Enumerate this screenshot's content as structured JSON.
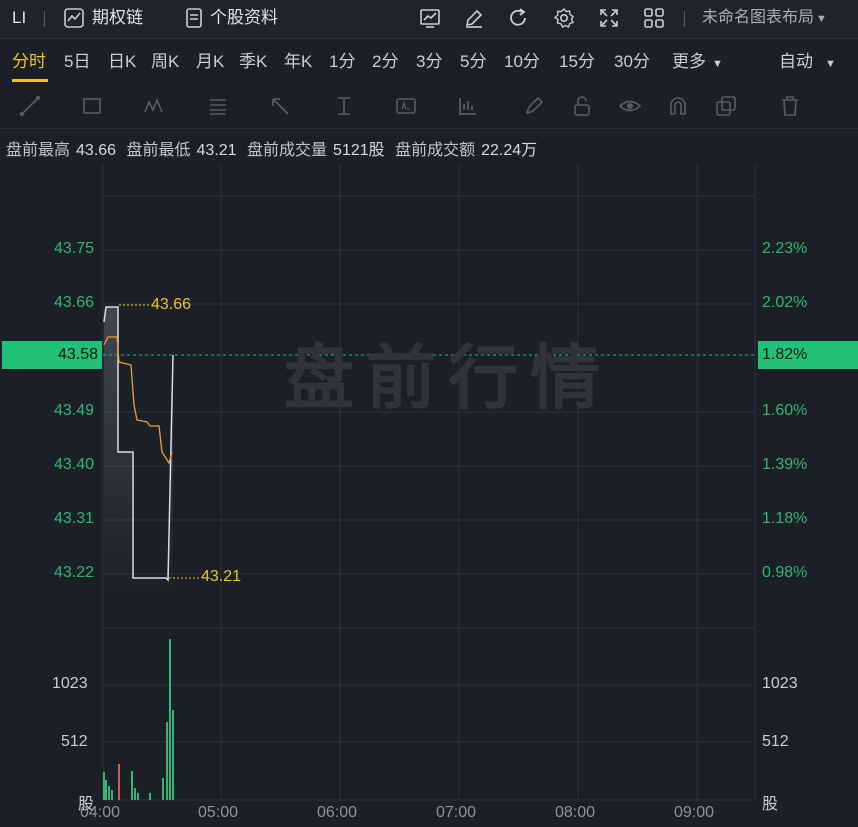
{
  "topbar": {
    "symbol": "LI",
    "options_chain": "期权链",
    "stock_profile": "个股资料",
    "layout_name": "未命名图表布局"
  },
  "periods": [
    "分时",
    "5日",
    "日K",
    "周K",
    "月K",
    "季K",
    "年K",
    "1分",
    "2分",
    "3分",
    "5分",
    "10分",
    "15分",
    "30分",
    "更多"
  ],
  "active_period": "分时",
  "auto_label": "自动",
  "premarket": {
    "high_label": "盘前最高",
    "high": "43.66",
    "low_label": "盘前最低",
    "low": "43.21",
    "volume_label": "盘前成交量",
    "volume": "5121股",
    "amount_label": "盘前成交额",
    "amount": "22.24万"
  },
  "watermark": "盘前行情",
  "price_axis": [
    "43.75",
    "43.66",
    "43.58",
    "43.49",
    "43.40",
    "43.31",
    "43.22"
  ],
  "percent_axis": [
    "2.23%",
    "2.02%",
    "1.82%",
    "1.60%",
    "1.39%",
    "1.18%",
    "0.98%"
  ],
  "current_price": "43.58",
  "current_percent": "1.82%",
  "high_marker": "43.66",
  "low_marker": "43.21",
  "volume_axis": [
    "1023",
    "512",
    "股"
  ],
  "time_axis": [
    "04:00",
    "05:00",
    "06:00",
    "07:00",
    "08:00",
    "09:00"
  ],
  "colors": {
    "up": "#2fb873",
    "down": "#e05252",
    "avg": "#f0a030",
    "price": "#d8dce3",
    "accent": "#f0c419"
  }
}
